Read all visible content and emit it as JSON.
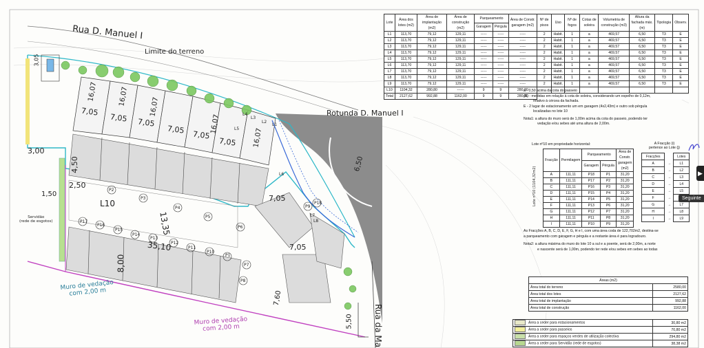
{
  "streets": {
    "rua_manuel": "Rua D. Manuel I",
    "limite": "Limite do terreno",
    "rotunda": "Rotunda D. Manuel I",
    "rua_ma": "Rua da Ma",
    "muro1_a": "Muro de vedação",
    "muro1_b": "com 2,00 m",
    "muro2_a": "Muro de vedação",
    "muro2_b": "com 2,00 m",
    "servidao_a": "Servidão",
    "servidao_b": "(rede de esgotos)"
  },
  "dims": {
    "d_305": "3,05",
    "d_150": "1,50",
    "d_1607a": "16,07",
    "d_1607b": "16,07",
    "d_1607c": "16,07",
    "d_1607d": "16,07",
    "d_1607e": "16,07",
    "d_705a": "7,05",
    "d_705b": "7,05",
    "d_705c": "7,05",
    "d_705d": "7,05",
    "d_705e": "7,05",
    "d_705f": "7,05",
    "d_705g": "7,05",
    "d_705h": "7,05",
    "d_300": "3,00",
    "d_450": "4,50",
    "d_250": "2,50",
    "d_1335": "13,35",
    "d_3510": "35,10",
    "d_800": "8,00",
    "d_650": "6,50",
    "d_550": "5,50",
    "d_760": "7,60",
    "l10": "L10",
    "lots": [
      "L1",
      "L2",
      "L3",
      "L4",
      "L5",
      "L6",
      "L7",
      "L8"
    ],
    "p_labels": [
      "P1",
      "P2",
      "P3",
      "P4",
      "P5",
      "P6",
      "P7",
      "P8",
      "P9",
      "P10",
      "P11",
      "P12",
      "P13",
      "P14",
      "P15",
      "P16",
      "P17",
      "P18"
    ]
  },
  "main_table": {
    "headers": [
      "Lote",
      "Área dos lotes (m2)",
      "Área de implantação (m2)",
      "Área de construção (m2)",
      "Parqueamento",
      "Área de Constr. garagem (m2)",
      "Nº de pisos",
      "Uso",
      "Nº de fogos",
      "Cotas de soleira",
      "Volumetria de construção (m3)",
      "Altura da fachada máx. (m)",
      "Tipologia",
      "Observ."
    ],
    "sub_headers": [
      "Garagem",
      "Pérgula"
    ],
    "rows": [
      [
        "L1",
        "113,70",
        "79,12",
        "129,11",
        "-----",
        "-----",
        "-----",
        "2",
        "Habit.",
        "1",
        "a",
        "469,57",
        "6,50",
        "T3",
        "E"
      ],
      [
        "L2",
        "113,70",
        "79,12",
        "129,11",
        "-----",
        "-----",
        "-----",
        "2",
        "Habit.",
        "1",
        "a",
        "469,57",
        "6,50",
        "T3",
        "E"
      ],
      [
        "L3",
        "113,70",
        "79,12",
        "129,11",
        "-----",
        "-----",
        "-----",
        "2",
        "Habit.",
        "1",
        "a",
        "469,57",
        "6,50",
        "T3",
        "E"
      ],
      [
        "L4",
        "113,70",
        "79,12",
        "129,11",
        "-----",
        "-----",
        "-----",
        "2",
        "Habit.",
        "1",
        "a",
        "469,57",
        "6,50",
        "T3",
        "E"
      ],
      [
        "L5",
        "113,70",
        "79,12",
        "129,11",
        "-----",
        "-----",
        "-----",
        "2",
        "Habit.",
        "1",
        "a",
        "469,57",
        "6,50",
        "T3",
        "E"
      ],
      [
        "L6",
        "113,70",
        "79,12",
        "129,11",
        "-----",
        "-----",
        "-----",
        "2",
        "Habit.",
        "1",
        "a",
        "469,57",
        "6,50",
        "T3",
        "E"
      ],
      [
        "L7",
        "113,70",
        "79,12",
        "129,11",
        "-----",
        "-----",
        "-----",
        "2",
        "Habit.",
        "1",
        "a",
        "469,57",
        "6,50",
        "T3",
        "E"
      ],
      [
        "L8",
        "113,70",
        "79,12",
        "129,11",
        "-----",
        "-----",
        "-----",
        "2",
        "Habit.",
        "1",
        "a",
        "469,57",
        "6,50",
        "T3",
        "E"
      ],
      [
        "L9",
        "113,70",
        "79,12",
        "129,11",
        "-----",
        "-----",
        "-----",
        "2",
        "Habit.",
        "1",
        "a",
        "469,57",
        "6,50",
        "T3",
        "E"
      ],
      [
        "L10",
        "1104,32",
        "280,80",
        "------",
        "9",
        "9",
        "280,80",
        "",
        "",
        "",
        "",
        "",
        "",
        "",
        ""
      ]
    ],
    "total": [
      "Total",
      "2127,62",
      "992,88",
      "1162,00",
      "9",
      "9",
      "280,80"
    ]
  },
  "notes": {
    "n1": "a  - 0,50 acima da cota do passeio",
    "n2": "(B)  - medidas em relação à cota de soleira, considerando um espelho de 0,12m,",
    "n3": "relativo à cércea da fachada.",
    "n4": "E  - 2 lugar de estacionamento um em garagem (4x2,43m) e outro sob pérgula",
    "n5": "localizadas no lote 10",
    "n6": "Nota1: a altura do muro será de 1,00m acima da cota do passeio, podendo ter",
    "n7": "vedação e/ou sebes até uma altura de 2,00m."
  },
  "lote10": {
    "title": "Lote nº10 em propriedade horizontal:",
    "side_label": "Lote nº10 (1104,32m2)",
    "headers": [
      "Fracção",
      "Permilagem",
      "Parqueamento",
      "Área de Constr. garagem (m2)"
    ],
    "sub_headers": [
      "Garagem",
      "Pérgula"
    ],
    "rows": [
      [
        "A",
        "111,11",
        "P18",
        "P1",
        "31,20"
      ],
      [
        "B",
        "111,11",
        "P17",
        "P2",
        "31,20"
      ],
      [
        "C",
        "111,11",
        "P16",
        "P3",
        "31,20"
      ],
      [
        "D",
        "111,11",
        "P15",
        "P4",
        "31,20"
      ],
      [
        "E",
        "111,11",
        "P14",
        "P5",
        "31,20"
      ],
      [
        "F",
        "111,11",
        "P13",
        "P6",
        "31,20"
      ],
      [
        "G",
        "111,11",
        "P12",
        "P7",
        "31,20"
      ],
      [
        "H",
        "111,11",
        "P11",
        "P8",
        "31,20"
      ],
      [
        "I",
        "111,11",
        "P10",
        "P9",
        "31,20"
      ]
    ]
  },
  "fraccao": {
    "title_a": "A Fracção (i)",
    "title_b": "pertence ao Lote (j)",
    "col_a": "Fracções",
    "col_b": "Lotes",
    "rows": [
      [
        "A",
        "L1"
      ],
      [
        "B",
        "L2"
      ],
      [
        "C",
        "L3"
      ],
      [
        "D",
        "L4"
      ],
      [
        "E",
        "L5"
      ],
      [
        "F",
        "L6"
      ],
      [
        "G",
        "L7"
      ],
      [
        "H",
        "L8"
      ],
      [
        "I",
        "L9"
      ]
    ]
  },
  "notes2": {
    "n1": "As Fracções A, B, C, D, E, F, G, H e I, com uma área coda de 122,702m2, destina-se",
    "n2": "a parqueamento com garagem e pérgula e a restante área é para logradouro.",
    "n3": "Nota2: a altura máxima do muro do lote 10 a sul e a poente, será de 2,00m, a norte",
    "n4": "e nascente será de 1,00m, podendo ter rede e/ou sebes em sebes ao todas"
  },
  "areas": {
    "title": "Áreas  (m2)",
    "rows": [
      [
        "Área total do terreno",
        "2580,00"
      ],
      [
        "Área total dos lotes",
        "2127,62"
      ],
      [
        "Área total de implantação",
        "992,88"
      ],
      [
        "Área total de construção",
        "1162,00"
      ]
    ]
  },
  "ceder": [
    {
      "label": "Área a ceder para estacionamentos",
      "value": "30,80 m2",
      "color": "#e8e8c8"
    },
    {
      "label": "Área a ceder para passeios",
      "value": "70,80 m2",
      "color": "#f2ef9a"
    },
    {
      "label": "Área a ceder para espaços verdes de utilização colectiva",
      "value": "294,80 m2",
      "color": "#c8e0a8"
    },
    {
      "label": "Área a ceder para Servidão (rede de esgotos)",
      "value": "38,38 m2",
      "color": "#b8d890"
    }
  ],
  "ui": {
    "next_arrow": "▶",
    "tooltip": "Seguinte"
  },
  "colors": {
    "cyan_boundary": "#2eb8c8",
    "magenta_boundary": "#c040c0",
    "road_gray": "#8a8a8a",
    "tree_green": "#7cc860"
  }
}
